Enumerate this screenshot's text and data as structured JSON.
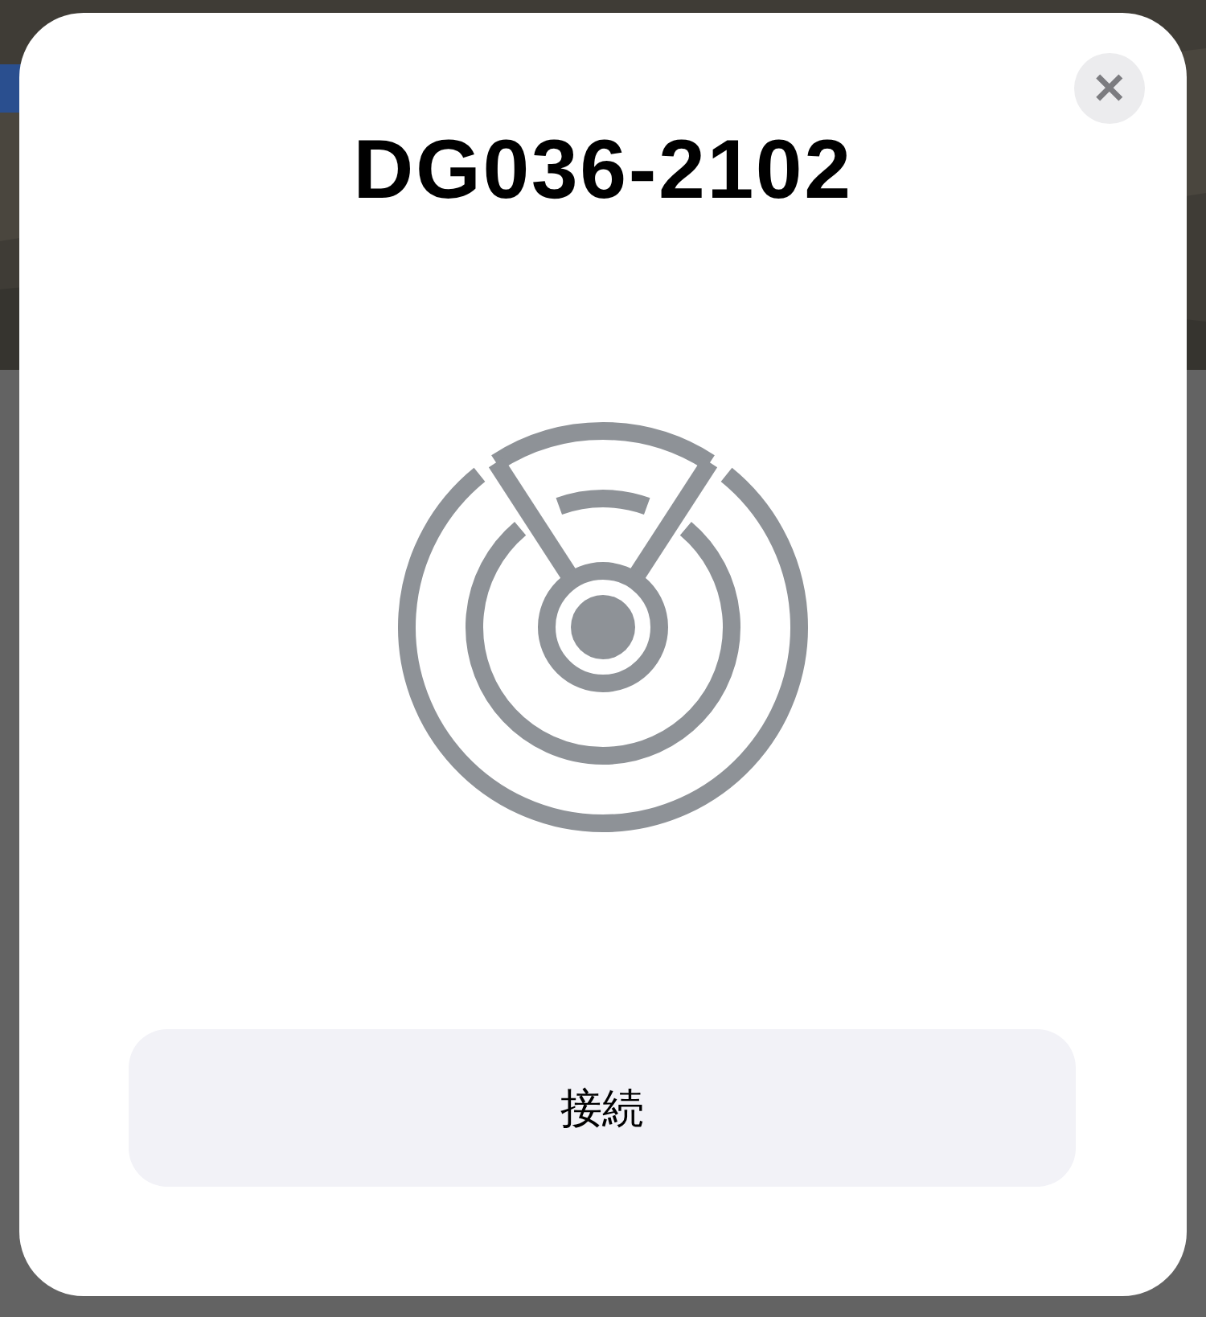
{
  "dialog": {
    "title": "DG036-2102",
    "close_button": "✕",
    "connect_button": "接続"
  }
}
